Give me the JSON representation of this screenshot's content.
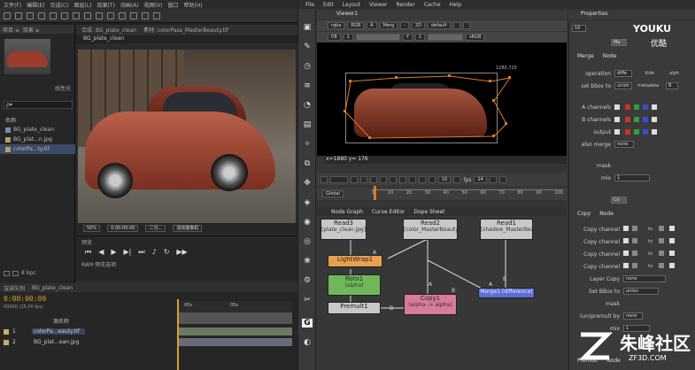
{
  "ae": {
    "menu": [
      "文件(F)",
      "编辑(E)",
      "合成(C)",
      "图层(L)",
      "效果(T)",
      "动画(A)",
      "视图(V)",
      "窗口",
      "帮助(H)"
    ],
    "project_tabs": [
      "项目 ≡",
      "效果 ≡"
    ],
    "project_label": "线性光",
    "project_search": "ρ▾",
    "project_header": "名称",
    "project_items": [
      "BG_plate_clean",
      "BG_plat...n.jpg",
      "colorPa...ty.tif"
    ],
    "project_footer": "8 bpc",
    "comp_tabs": [
      "合成: BG_plate_clean",
      "素材: colorPass_MasterBeauty.tif"
    ],
    "comp_subtab": "BG_plate_clean",
    "comp_footer": [
      "50%",
      "0:00:00:00",
      "二分...",
      "活动摄像机"
    ],
    "preview_tab": "预览",
    "preview_ram": "RAM 预览选项",
    "timeline_tabs": [
      "渲染队列",
      "BG_plate_clean"
    ],
    "timecode": "0:00:00:00",
    "timecode_sub": "00000 (25.00 fps)",
    "layer_header": "源名称",
    "layers": [
      {
        "num": "1",
        "name": "colorPa...eauty.tif"
      },
      {
        "num": "2",
        "name": "BG_plat...ean.jpg"
      }
    ],
    "ruler_marks": [
      "00s",
      "05s"
    ]
  },
  "nuke": {
    "menu": [
      "File",
      "Edit",
      "Layout",
      "Viewer",
      "Render",
      "Cache",
      "Help"
    ],
    "viewer_tab": "Viewer1",
    "bar1": [
      "rgba",
      "RGB",
      "A",
      "Merg",
      "-",
      "2D",
      "default"
    ],
    "bar2": [
      "f/8",
      "1",
      "Y",
      "1",
      "sRGB"
    ],
    "resolution": "1280,720",
    "coords": "x=1880 y= 176",
    "fps_label": "fps",
    "fps_value": "24",
    "frame_field": "10",
    "global_label": "Global",
    "ruler": [
      "1",
      "10",
      "20",
      "30",
      "40",
      "50",
      "60",
      "70",
      "80",
      "90",
      "100"
    ],
    "node_tabs": [
      "Node Graph",
      "Curve Editor",
      "Dope Sheet"
    ],
    "nodes": {
      "read3": {
        "title": "Read3",
        "sub": "[plate_clean.jpg]"
      },
      "read2": {
        "title": "Read2",
        "sub": "[color_MasterBeauty.tif]"
      },
      "read1": {
        "title": "Read1",
        "sub": "[shadow_MasterBeauty.tif]"
      },
      "lightwrap": {
        "title": "LightWrap1"
      },
      "roto": {
        "title": "Roto1",
        "sub": "(alpha)"
      },
      "premult": {
        "title": "Premult1"
      },
      "copy": {
        "title": "Copy1",
        "sub": "(alpha -> alpha)"
      },
      "merge": {
        "title": "Merge1 (difference)"
      }
    },
    "edge_labels": [
      "A",
      "B",
      "A",
      "B",
      "A",
      "B"
    ],
    "props_tab": "Properties",
    "props_field": "10",
    "merge_node_name": "Me",
    "merge_tabs": [
      "Merge",
      "Node"
    ],
    "merge_rows": [
      {
        "label": "operation",
        "value": "diffe"
      },
      {
        "label": "set bbox to",
        "value": "union"
      },
      {
        "label": "A channels",
        "value": ""
      },
      {
        "label": "B channels",
        "value": ""
      },
      {
        "label": "output",
        "value": ""
      },
      {
        "label": "also merge",
        "value": "none"
      },
      {
        "label": "mask",
        "value": ""
      },
      {
        "label": "mix",
        "value": "1"
      }
    ],
    "merge_extra": [
      "Vide",
      "alph",
      "metadata",
      "B"
    ],
    "copy_node_name": "Co",
    "copy_tabs": [
      "Copy",
      "Node"
    ],
    "copy_rows": [
      {
        "label": "Copy channel",
        "value": "to"
      },
      {
        "label": "Copy channel",
        "value": "to"
      },
      {
        "label": "Copy channel",
        "value": "to"
      },
      {
        "label": "Copy channel",
        "value": "to"
      },
      {
        "label": "Layer Copy",
        "value": "none"
      },
      {
        "label": "Set BBox to",
        "value": "union"
      },
      {
        "label": "mask",
        "value": ""
      },
      {
        "label": "(un)premult by",
        "value": "none"
      },
      {
        "label": "mix",
        "value": "1"
      }
    ],
    "bottom_tabs": [
      "Premult",
      "Node"
    ]
  },
  "watermark": {
    "top": "YOUKU",
    "top_sub": "优酷",
    "logo_cn": "朱峰社区",
    "logo_url": "ZF3D.COM"
  },
  "colors": {
    "node_read": "#c8c8c8",
    "node_lightwrap": "#e8a050",
    "node_roto": "#6fb85a",
    "node_copy": "#d87a9a",
    "node_merge": "#5b6fd8",
    "ae_timecode": "#e0a020"
  }
}
